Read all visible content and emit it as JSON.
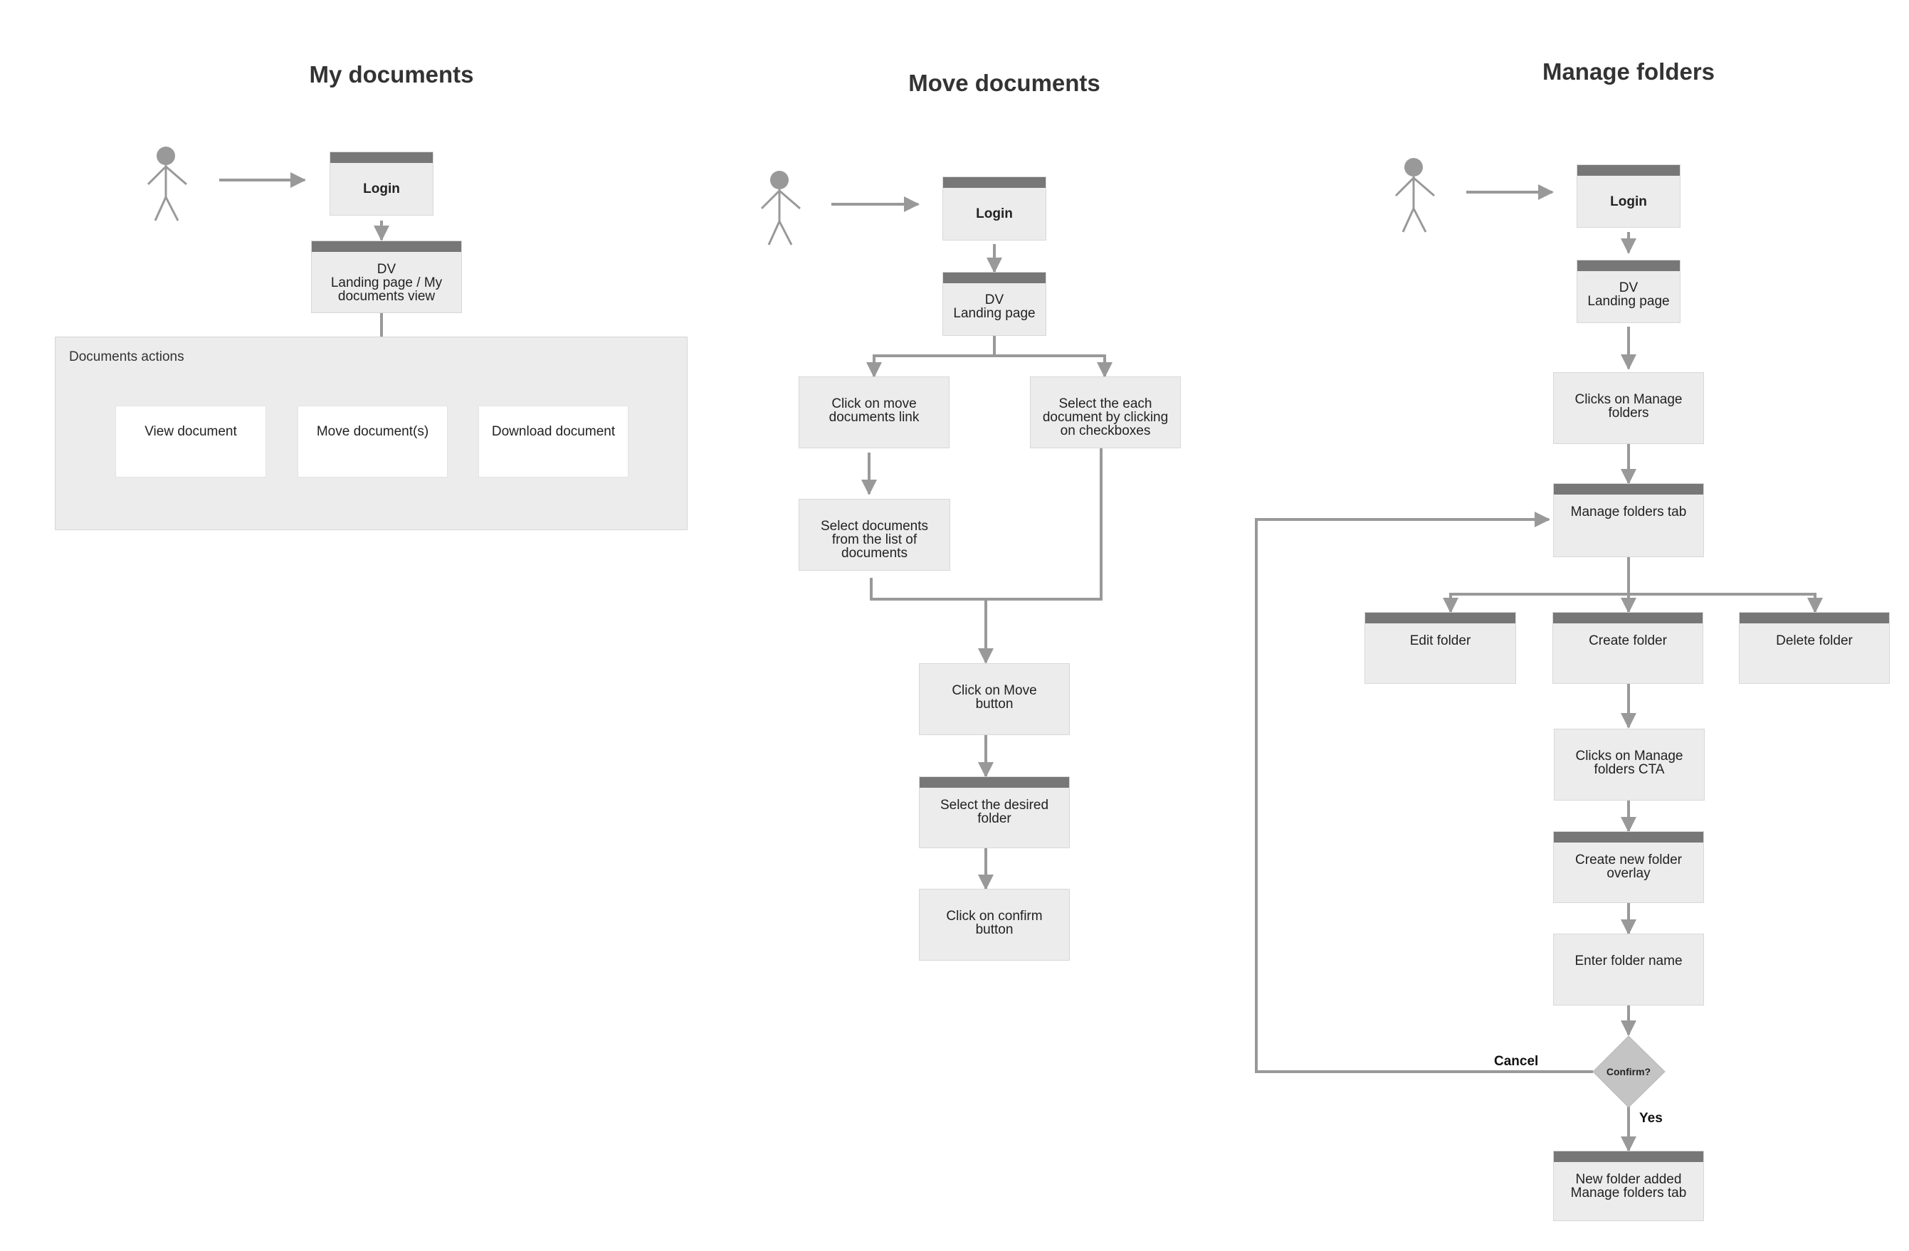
{
  "colors": {
    "box_fill": "#ececec",
    "header_bar": "#777777",
    "connector": "#999999",
    "actor": "#999999",
    "decision_fill": "#c4c4c4",
    "title_text": "#333333"
  },
  "sections": [
    {
      "title": "My documents",
      "actor_icon": "stick-figure-user",
      "nodes": {
        "login": "Login",
        "landing": "DV\nLanding page / My\ndocuments view"
      },
      "group": {
        "title": "Documents actions",
        "items": [
          "View document",
          "Move document(s)",
          "Download document"
        ]
      }
    },
    {
      "title": "Move documents",
      "actor_icon": "stick-figure-user",
      "nodes": {
        "login": "Login",
        "landing": "DV\nLanding page",
        "move_link": "Click on move\ndocuments link",
        "select_checkbox": "Select the each\ndocument by clicking\non checkboxes",
        "select_list": "Select documents\nfrom the list of\ndocuments",
        "move_button": "Click on Move\nbutton",
        "select_folder": "Select the desired\nfolder",
        "confirm_button": "Click on confirm\nbutton"
      }
    },
    {
      "title": "Manage folders",
      "actor_icon": "stick-figure-user",
      "nodes": {
        "login": "Login",
        "landing": "DV\nLanding page",
        "clicks_manage": "Clicks on Manage\nfolders",
        "manage_tab": "Manage folders tab",
        "edit_folder": "Edit folder",
        "create_folder": "Create folder",
        "delete_folder": "Delete folder",
        "clicks_cta": "Clicks on Manage\nfolders CTA",
        "create_overlay": "Create new folder\noverlay",
        "enter_name": "Enter folder name",
        "decision": "Confirm?",
        "new_folder_added": "New folder added\nManage folders tab"
      },
      "edge_labels": {
        "cancel": "Cancel",
        "yes": "Yes"
      }
    }
  ]
}
